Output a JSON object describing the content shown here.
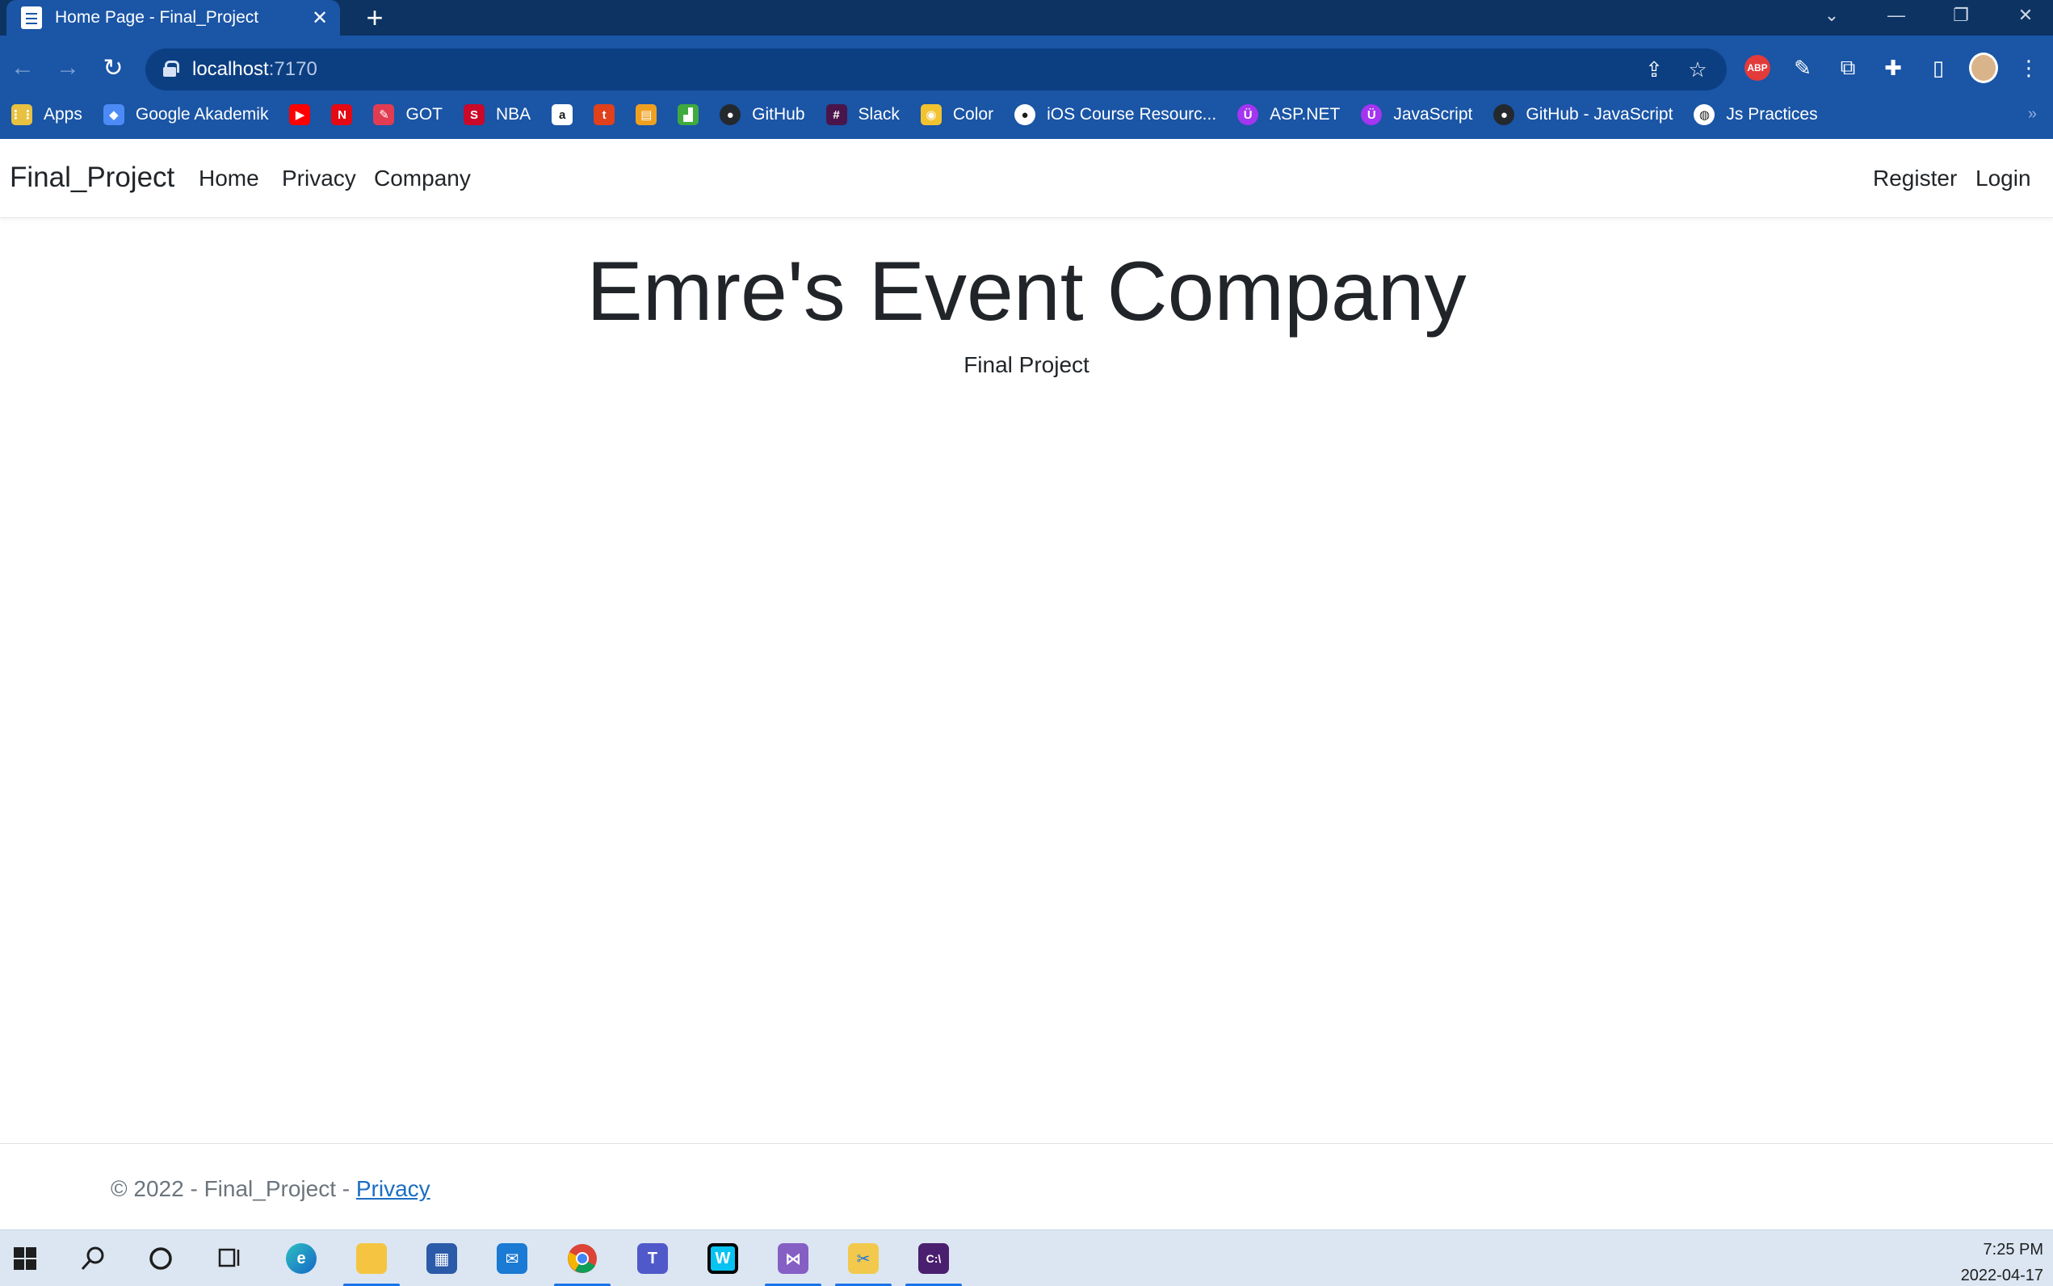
{
  "browser": {
    "tab_title": "Home Page - Final_Project",
    "tab_close": "✕",
    "new_tab": "+",
    "url_host": "localhost",
    "url_port": ":7170",
    "window_controls": {
      "minimize": "—",
      "restore": "❐",
      "close": "✕",
      "tab_search": "⌄"
    },
    "extensions": {
      "abp": "ABP"
    },
    "bookmarks": [
      {
        "label": "Apps",
        "icon": "apps-grid-icon",
        "color": "#e8c141"
      },
      {
        "label": "Google Akademik",
        "icon": "google-scholar-icon",
        "color": "#4c8bf5"
      },
      {
        "label": "",
        "icon": "youtube-icon",
        "color": "#ff0000"
      },
      {
        "label": "",
        "icon": "netflix-icon",
        "color": "#e50914"
      },
      {
        "label": "GOT",
        "icon": "got-icon",
        "color": "#e23c52"
      },
      {
        "label": "NBA",
        "icon": "nba-icon",
        "color": "#c9082a"
      },
      {
        "label": "",
        "icon": "amazon-icon",
        "color": "#ffffff"
      },
      {
        "label": "",
        "icon": "t-icon",
        "color": "#e0401c"
      },
      {
        "label": "",
        "icon": "notes-icon",
        "color": "#f0a020"
      },
      {
        "label": "",
        "icon": "chart-icon",
        "color": "#3faa3f"
      },
      {
        "label": "GitHub",
        "icon": "github-icon",
        "color": "#24292e"
      },
      {
        "label": "Slack",
        "icon": "slack-icon",
        "color": "#4a154b"
      },
      {
        "label": "Color",
        "icon": "color-icon",
        "color": "#f2c230"
      },
      {
        "label": "iOS Course Resourc...",
        "icon": "ios-course-icon",
        "color": "#ffffff"
      },
      {
        "label": "ASP.NET",
        "icon": "udemy-icon",
        "color": "#a435f0"
      },
      {
        "label": "JavaScript",
        "icon": "udemy-icon",
        "color": "#a435f0"
      },
      {
        "label": "GitHub - JavaScript",
        "icon": "github-icon",
        "color": "#24292e"
      },
      {
        "label": "Js Practices",
        "icon": "globe-icon",
        "color": "#ffffff"
      }
    ],
    "bookmarks_overflow": "»"
  },
  "site": {
    "brand": "Final_Project",
    "nav": {
      "home": "Home",
      "privacy": "Privacy",
      "company": "Company",
      "register": "Register",
      "login": "Login"
    },
    "hero_title": "Emre's Event Company",
    "hero_subtitle": "Final Project",
    "footer_prefix": "© 2022 - Final_Project - ",
    "footer_link": "Privacy"
  },
  "taskbar": {
    "time": "7:25 PM",
    "date": "2022-04-17"
  },
  "colors": {
    "chrome_dark": "#0c3362",
    "chrome": "#1a55a6",
    "link": "#1b6ec2",
    "taskbar": "#dbe6f2"
  }
}
